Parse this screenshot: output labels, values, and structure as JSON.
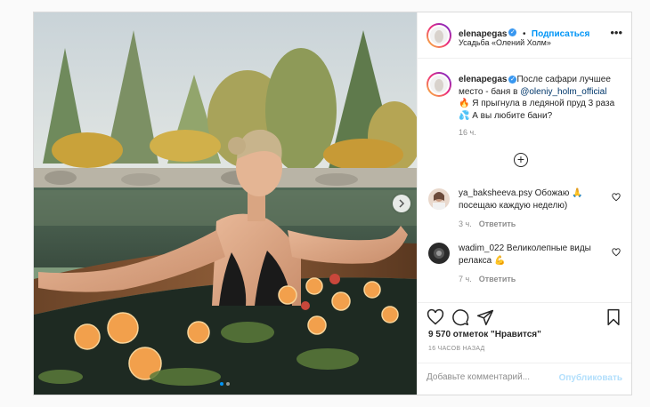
{
  "post": {
    "username": "elenapegas",
    "follow_label": "Подписаться",
    "separator": "•",
    "location": "Усадьба «Олений Холм»",
    "more_label": "•••"
  },
  "caption": {
    "username": "elenapegas",
    "text_1": "После сафари лучшее место - баня в ",
    "mention": "@oleniy_holm_official",
    "text_2": " 🔥 Я прыгнула в ледяной пруд 3 раза💦 А вы любите бани?",
    "time": "16 ч."
  },
  "load_more_label": "+",
  "comments": [
    {
      "username": "ya_baksheeva.psy",
      "text": " Обожаю 🙏 посещаю каждую неделю)",
      "time": "3 ч.",
      "reply_label": "Ответить"
    },
    {
      "username": "wadim_022",
      "text": " Великолепные виды релакса 💪",
      "time": "7 ч.",
      "reply_label": "Ответить"
    }
  ],
  "likes_text": "9 570 отметок \"Нравится\"",
  "time_ago": "16 ЧАСОВ НАЗАД",
  "comment_placeholder": "Добавьте комментарий...",
  "publish_label": "Опубликовать",
  "icons": [
    "heart-icon",
    "comment-icon",
    "share-icon",
    "save-icon",
    "verified-icon",
    "plus-icon",
    "next-arrow-icon"
  ],
  "colors": {
    "accent": "#0095f6",
    "verified": "#3897f0",
    "publish_disabled": "#b2dffc",
    "muted": "#8e8e8e"
  },
  "carousel": {
    "slides": 2,
    "active_slide": 1
  }
}
